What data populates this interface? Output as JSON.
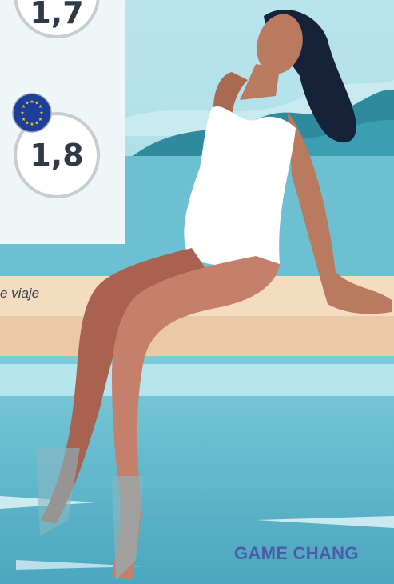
{
  "stats": {
    "top_value": "1,7",
    "bottom_value": "1,8"
  },
  "caption_text": "e viaje",
  "footer_text": "GAME CHANG",
  "icons": {
    "eu_badge": "eu-flag-icon"
  },
  "colors": {
    "sky": "#a9dde6",
    "sea": "#62b8cb",
    "sand": "#f3dcc0",
    "mountain": "#2f8a9d",
    "panel": "#eef6f8",
    "accent_text": "#4a5ca8"
  }
}
